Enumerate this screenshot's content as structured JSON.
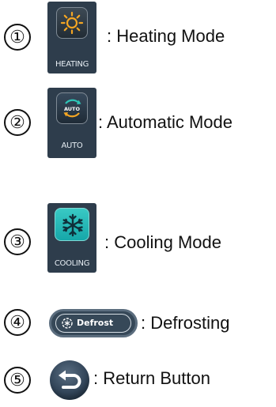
{
  "items": [
    {
      "number": "①",
      "icon": "sun-icon",
      "caption": "HEATING",
      "description": ": Heating Mode",
      "accent": "#f5a623"
    },
    {
      "number": "②",
      "icon": "auto-cycle-icon",
      "caption": "AUTO",
      "badge": "AUTO",
      "description": ": Automatic Mode",
      "accent": "#2ec4b6"
    },
    {
      "number": "③",
      "icon": "snowflake-icon",
      "caption": "COOLING",
      "description": ": Cooling Mode",
      "accent": "#1ec8c8"
    },
    {
      "number": "④",
      "icon": "defrost-icon",
      "label": "Defrost",
      "description": ": Defrosting"
    },
    {
      "number": "⑤",
      "icon": "return-arrow-icon",
      "description": ": Return Button"
    }
  ]
}
